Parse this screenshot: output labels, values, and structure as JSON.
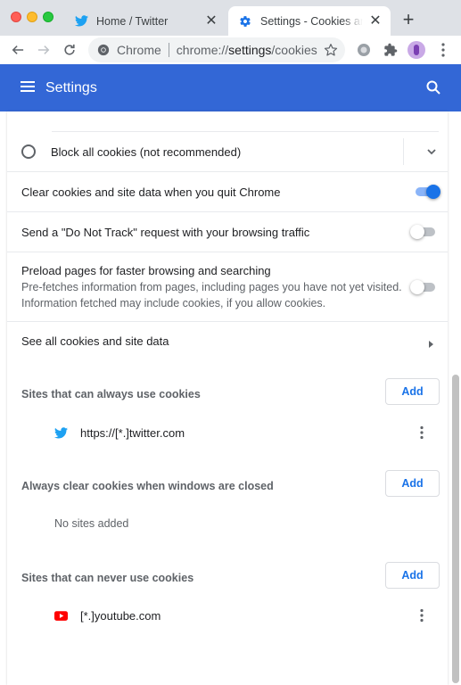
{
  "browser": {
    "tabs": [
      {
        "title": "Home / Twitter",
        "favicon": "twitter-bird-icon",
        "active": false
      },
      {
        "title": "Settings - Cookies and other site data",
        "favicon": "settings-gear-icon",
        "active": true
      }
    ],
    "omnibox": {
      "chip": "Chrome",
      "url_prefix": "chrome://",
      "url_host": "settings",
      "url_path": "/cookies"
    }
  },
  "header": {
    "title": "Settings"
  },
  "cookies": {
    "block_all": {
      "label": "Block all cookies (not recommended)",
      "selected": false
    },
    "clear_on_quit": {
      "label": "Clear cookies and site data when you quit Chrome",
      "enabled": true
    },
    "do_not_track": {
      "label": "Send a \"Do Not Track\" request with your browsing traffic",
      "enabled": false
    },
    "preload": {
      "label": "Preload pages for faster browsing and searching",
      "description_line1": "Pre-fetches information from pages, including pages you have not yet visited.",
      "description_line2": "Information fetched may include cookies, if you allow cookies.",
      "enabled": false
    },
    "see_all": {
      "label": "See all cookies and site data"
    }
  },
  "site_lists": {
    "always_allow": {
      "title": "Sites that can always use cookies",
      "add_label": "Add",
      "sites": [
        {
          "name": "https://[*.]twitter.com",
          "icon": "twitter-bird-icon"
        }
      ]
    },
    "clear_on_exit": {
      "title": "Always clear cookies when windows are closed",
      "add_label": "Add",
      "empty_text": "No sites added"
    },
    "never_allow": {
      "title": "Sites that can never use cookies",
      "add_label": "Add",
      "sites": [
        {
          "name": "[*.]youtube.com",
          "icon": "youtube-icon"
        }
      ]
    }
  },
  "colors": {
    "header_blue": "#3367d6",
    "accent_blue": "#1a73e8",
    "twitter_blue": "#1da1f2",
    "youtube_red": "#ff0000"
  }
}
